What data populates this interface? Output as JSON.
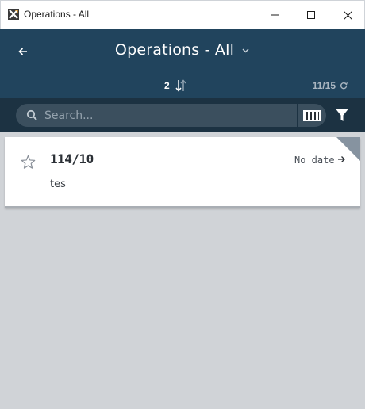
{
  "window": {
    "title": "Operations - All",
    "icon": "x-app-icon",
    "controls": [
      "minimize-icon",
      "maximize-icon",
      "close-icon"
    ]
  },
  "header": {
    "title": "Operations - All",
    "back_icon": "back-arrow-icon",
    "title_dropdown_icon": "chevron-down-icon",
    "sort_count": "2",
    "sort_icon": "sort-arrows-icon",
    "sync_status": "11/15",
    "sync_icon": "sync-icon"
  },
  "search": {
    "placeholder": "Search...",
    "value": "",
    "barcode_icon": "barcode-icon",
    "filter_icon": "filter-icon"
  },
  "operations": [
    {
      "number": "114/10",
      "date": "No date",
      "description": "tes",
      "favorite": false
    }
  ],
  "colors": {
    "header_bg": "#21445d",
    "searchbar_bg": "#1c3242",
    "search_box_bg": "#3b4f5e",
    "page_bg": "#d0d3d7",
    "card_corner": "#8693a0"
  }
}
